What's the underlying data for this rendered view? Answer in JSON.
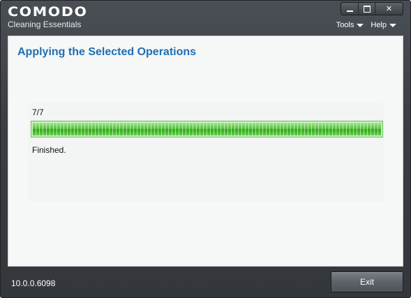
{
  "app": {
    "brand": "COMODO",
    "subtitle": "Cleaning Essentials"
  },
  "window_controls": {
    "minimize": "minimize",
    "maximize": "maximize",
    "close": "✕"
  },
  "menu": {
    "items": [
      {
        "label": "Tools"
      },
      {
        "label": "Help"
      }
    ]
  },
  "main": {
    "heading": "Applying the Selected Operations",
    "count": "7/7",
    "progress": 1.0,
    "status": "Finished."
  },
  "footer": {
    "version": "10.0.0.6098",
    "exit_label": "Exit"
  },
  "colors": {
    "heading": "#1f6fb4",
    "progress_green": "#58c43c",
    "chrome": "#3b3f44"
  }
}
